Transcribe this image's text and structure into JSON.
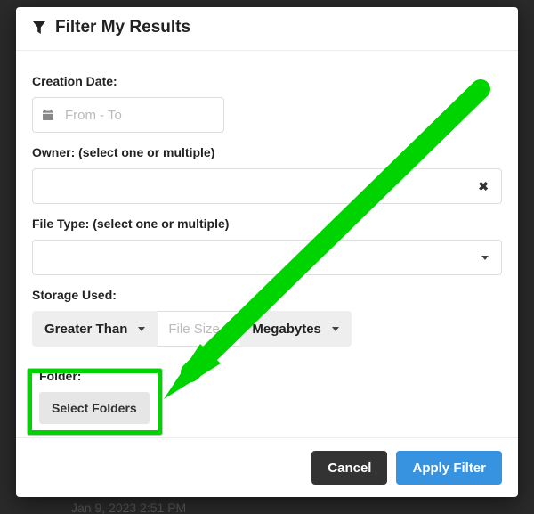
{
  "header": {
    "title": "Filter My Results"
  },
  "creationDate": {
    "label": "Creation Date:",
    "placeholder": "From - To"
  },
  "owner": {
    "label": "Owner: (select one or multiple)"
  },
  "fileType": {
    "label": "File Type: (select one or multiple)"
  },
  "storage": {
    "label": "Storage Used:",
    "comparator": "Greater Than",
    "sizePlaceholder": "File Size",
    "unit": "Megabytes"
  },
  "folder": {
    "label": "Folder:",
    "button": "Select Folders"
  },
  "footer": {
    "cancel": "Cancel",
    "apply": "Apply Filter"
  },
  "background": {
    "timestamp": "Jan 9, 2023 2:51 PM"
  }
}
